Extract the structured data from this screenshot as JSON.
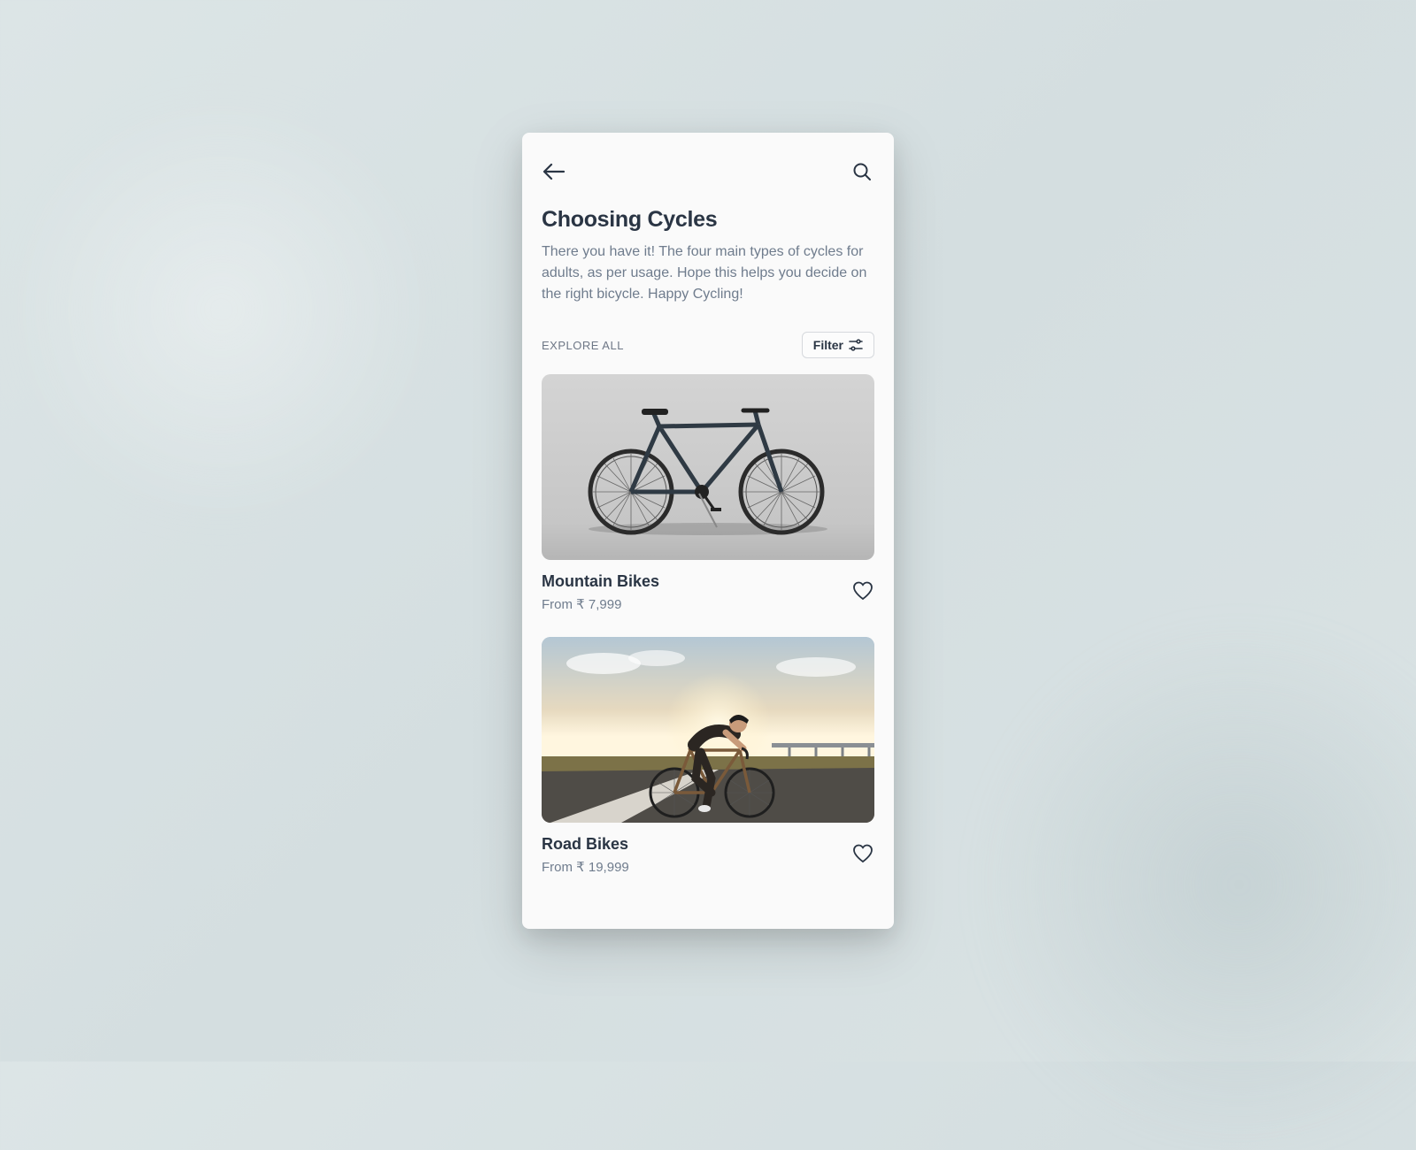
{
  "header": {
    "title": "Choosing Cycles",
    "subtitle": "There you have it! The four main types of cycles for adults, as per usage. Hope this helps you decide on the right bicycle. Happy Cycling!"
  },
  "section": {
    "label": "EXPLORE ALL",
    "filter_label": "Filter"
  },
  "cards": [
    {
      "title": "Mountain Bikes",
      "price": "From ₹ 7,999"
    },
    {
      "title": "Road Bikes",
      "price": "From ₹ 19,999"
    }
  ]
}
